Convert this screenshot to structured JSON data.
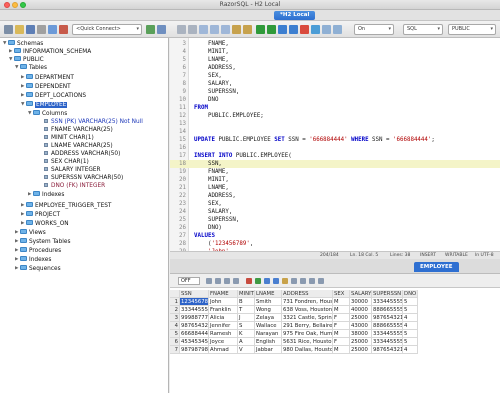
{
  "window": {
    "title": "RazorSQL - H2 Local"
  },
  "connection_tab": {
    "label": "*H2 Local"
  },
  "toolbar": {
    "quick_connect": "<Quick Connect>",
    "on_select": "On",
    "db_type": "SQL",
    "schema_select": "PUBLIC"
  },
  "tree": {
    "schemas": "Schemas",
    "information_schema": "INFORMATION_SCHEMA",
    "public": "PUBLIC",
    "tables": "Tables",
    "department": "DEPARTMENT",
    "dependent": "DEPENDENT",
    "dept_locations": "DEPT_LOCATIONS",
    "employee": "EMPLOYEE",
    "columns": "Columns",
    "cols": [
      "SSN (PK) VARCHAR(25) Not Null",
      "FNAME VARCHAR(25)",
      "MINIT CHAR(1)",
      "LNAME VARCHAR(25)",
      "ADDRESS VARCHAR(50)",
      "SEX CHAR(1)",
      "SALARY INTEGER",
      "SUPERSSN VARCHAR(50)",
      "DNO (FK) INTEGER"
    ],
    "indexes": "Indexes",
    "employee_trigger_test": "EMPLOYEE_TRIGGER_TEST",
    "project": "PROJECT",
    "works_on": "WORKS_ON",
    "views": "Views",
    "system_tables": "System Tables",
    "procedures": "Procedures",
    "indexes2": "Indexes",
    "sequences": "Sequences"
  },
  "editor": {
    "lines": [
      {
        "n": "3",
        "t": "    FNAME,"
      },
      {
        "n": "4",
        "t": "    MINIT,"
      },
      {
        "n": "5",
        "t": "    LNAME,"
      },
      {
        "n": "6",
        "t": "    ADDRESS,"
      },
      {
        "n": "7",
        "t": "    SEX,"
      },
      {
        "n": "8",
        "t": "    SALARY,"
      },
      {
        "n": "9",
        "t": "    SUPERSSN,"
      },
      {
        "n": "10",
        "t": "    DNO"
      },
      {
        "n": "11",
        "t": "FROM"
      },
      {
        "n": "12",
        "t": "    PUBLIC.EMPLOYEE;"
      },
      {
        "n": "13",
        "t": ""
      },
      {
        "n": "14",
        "t": ""
      },
      {
        "n": "15",
        "t": "UPDATE PUBLIC.EMPLOYEE SET SSN = '666884444' WHERE SSN = '666884444';"
      },
      {
        "n": "16",
        "t": ""
      },
      {
        "n": "17",
        "t": "INSERT INTO PUBLIC.EMPLOYEE("
      },
      {
        "n": "18",
        "t": "    SSN,"
      },
      {
        "n": "19",
        "t": "    FNAME,"
      },
      {
        "n": "20",
        "t": "    MINIT,"
      },
      {
        "n": "21",
        "t": "    LNAME,"
      },
      {
        "n": "22",
        "t": "    ADDRESS,"
      },
      {
        "n": "23",
        "t": "    SEX,"
      },
      {
        "n": "24",
        "t": "    SALARY,"
      },
      {
        "n": "25",
        "t": "    SUPERSSN,"
      },
      {
        "n": "26",
        "t": "    DNO)"
      },
      {
        "n": "27",
        "t": "VALUES"
      },
      {
        "n": "28",
        "t": "    ('123456789',"
      },
      {
        "n": "29",
        "t": "    'John',"
      },
      {
        "n": "30",
        "t": "    'B',"
      }
    ]
  },
  "status": {
    "pos": "204/184",
    "ln": "Ln. 18 Col. 5",
    "lines": "Lines: 38",
    "mode": "INSERT",
    "writable": "WRITABLE",
    "enc": "ln UTF-8"
  },
  "results": {
    "tab": "EMPLOYEE",
    "offset": "OFF",
    "headers": [
      "SSN",
      "FNAME",
      "MINIT",
      "LNAME",
      "ADDRESS",
      "SEX",
      "SALARY",
      "SUPERSSN",
      "DNO"
    ],
    "rows": [
      [
        "1",
        "123456789",
        "John",
        "B",
        "Smith",
        "731 Fondren, Houston TX",
        "M",
        "30000",
        "333445555",
        "5"
      ],
      [
        "2",
        "333445555",
        "Franklin",
        "T",
        "Wong",
        "638 Voss, Houston TX",
        "M",
        "40000",
        "888665555",
        "5"
      ],
      [
        "3",
        "999887777",
        "Alicia",
        "J",
        "Zelaya",
        "3321 Castle, Spring TX",
        "F",
        "25000",
        "987654321",
        "4"
      ],
      [
        "4",
        "987654321",
        "Jennifer",
        "S",
        "Wallace",
        "291 Berry, Bellaire, TX",
        "F",
        "43000",
        "888665555",
        "4"
      ],
      [
        "5",
        "666884444",
        "Ramesh",
        "K",
        "Narayan",
        "975 Fire Oak, Humble TX",
        "M",
        "38000",
        "333445555",
        "5"
      ],
      [
        "6",
        "453453453",
        "Joyce",
        "A",
        "English",
        "5631 Rice, Houston TX",
        "F",
        "25000",
        "333445555",
        "5"
      ],
      [
        "7",
        "987987987",
        "Ahmad",
        "V",
        "Jabbar",
        "980 Dallas, Houston TX",
        "M",
        "25000",
        "987654321",
        "4"
      ]
    ]
  }
}
